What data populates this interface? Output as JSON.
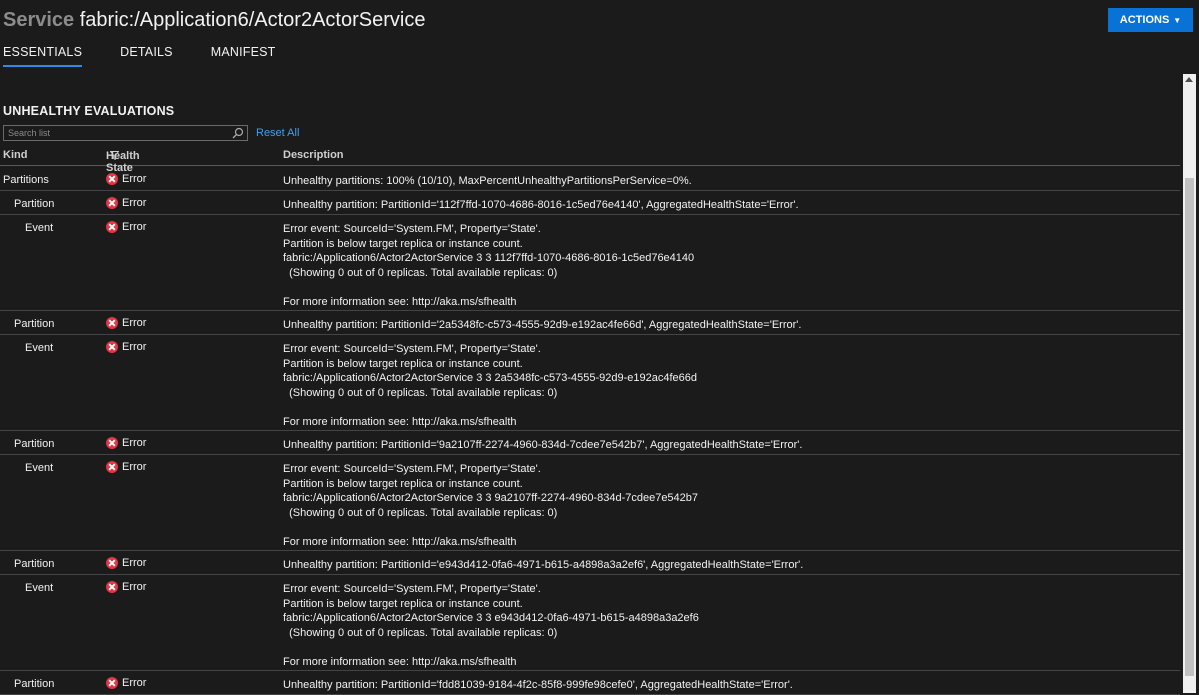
{
  "header": {
    "service_label": "Service",
    "service_name": "fabric:/Application6/Actor2ActorService",
    "actions_label": "ACTIONS"
  },
  "tabs": [
    {
      "label": "ESSENTIALS",
      "active": true
    },
    {
      "label": "DETAILS",
      "active": false
    },
    {
      "label": "MANIFEST",
      "active": false
    }
  ],
  "section": {
    "title": "UNHEALTHY EVALUATIONS",
    "search_placeholder": "Search list",
    "reset_label": "Reset All"
  },
  "columns": {
    "kind": "Kind",
    "health": "Health State",
    "description": "Description"
  },
  "rows": [
    {
      "kind": "Partitions",
      "health": "Error",
      "desc": [
        "Unhealthy partitions: 100% (10/10), MaxPercentUnhealthyPartitionsPerService=0%."
      ]
    },
    {
      "kind": "Partition",
      "health": "Error",
      "desc": [
        "Unhealthy partition: PartitionId='112f7ffd-1070-4686-8016-1c5ed76e4140', AggregatedHealthState='Error'."
      ]
    },
    {
      "kind": "Event",
      "health": "Error",
      "desc": [
        "Error event: SourceId='System.FM', Property='State'.",
        "Partition is below target replica or instance count.",
        "fabric:/Application6/Actor2ActorService 3 3 112f7ffd-1070-4686-8016-1c5ed76e4140",
        "  (Showing 0 out of 0 replicas. Total available replicas: 0)",
        "",
        "For more information see: http://aka.ms/sfhealth"
      ]
    },
    {
      "kind": "Partition",
      "health": "Error",
      "desc": [
        "Unhealthy partition: PartitionId='2a5348fc-c573-4555-92d9-e192ac4fe66d', AggregatedHealthState='Error'."
      ]
    },
    {
      "kind": "Event",
      "health": "Error",
      "desc": [
        "Error event: SourceId='System.FM', Property='State'.",
        "Partition is below target replica or instance count.",
        "fabric:/Application6/Actor2ActorService 3 3 2a5348fc-c573-4555-92d9-e192ac4fe66d",
        "  (Showing 0 out of 0 replicas. Total available replicas: 0)",
        "",
        "For more information see: http://aka.ms/sfhealth"
      ]
    },
    {
      "kind": "Partition",
      "health": "Error",
      "desc": [
        "Unhealthy partition: PartitionId='9a2107ff-2274-4960-834d-7cdee7e542b7', AggregatedHealthState='Error'."
      ]
    },
    {
      "kind": "Event",
      "health": "Error",
      "desc": [
        "Error event: SourceId='System.FM', Property='State'.",
        "Partition is below target replica or instance count.",
        "fabric:/Application6/Actor2ActorService 3 3 9a2107ff-2274-4960-834d-7cdee7e542b7",
        "  (Showing 0 out of 0 replicas. Total available replicas: 0)",
        "",
        "For more information see: http://aka.ms/sfhealth"
      ]
    },
    {
      "kind": "Partition",
      "health": "Error",
      "desc": [
        "Unhealthy partition: PartitionId='e943d412-0fa6-4971-b615-a4898a3a2ef6', AggregatedHealthState='Error'."
      ]
    },
    {
      "kind": "Event",
      "health": "Error",
      "desc": [
        "Error event: SourceId='System.FM', Property='State'.",
        "Partition is below target replica or instance count.",
        "fabric:/Application6/Actor2ActorService 3 3 e943d412-0fa6-4971-b615-a4898a3a2ef6",
        "  (Showing 0 out of 0 replicas. Total available replicas: 0)",
        "",
        "For more information see: http://aka.ms/sfhealth"
      ]
    },
    {
      "kind": "Partition",
      "health": "Error",
      "desc": [
        "Unhealthy partition: PartitionId='fdd81039-9184-4f2c-85f8-999fe98cefe0', AggregatedHealthState='Error'."
      ]
    }
  ]
}
